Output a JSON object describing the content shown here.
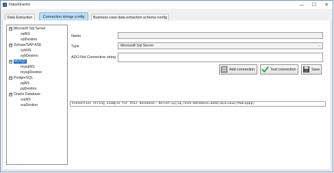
{
  "window": {
    "title": "DataXtractor",
    "minimize_glyph": "—",
    "maximize_glyph": "☐",
    "close_glyph": "✕"
  },
  "tabs": [
    {
      "label": "Data Extraction",
      "active": false
    },
    {
      "label": "Connection strings config",
      "active": true
    },
    {
      "label": "Business case data extraction schema config",
      "active": false
    }
  ],
  "tree": {
    "groups": [
      {
        "label": "Microsoft Sql Server",
        "expander": "⊟",
        "children": [
          "sqlNS",
          "sqlDestino"
        ]
      },
      {
        "label": "Sybase/SAP ASE",
        "expander": "⊟",
        "children": [
          "sybNS",
          "sybDestino"
        ]
      },
      {
        "label": "MySQL",
        "expander": "⊟",
        "selected": true,
        "children": [
          "mysqlNS",
          "mysqlDestino"
        ]
      },
      {
        "label": "PostgreSQL",
        "expander": "⊟",
        "children": [
          "pgNS",
          "pgDestino"
        ]
      },
      {
        "label": "Oracle Database",
        "expander": "⊟",
        "children": [
          "oraNS",
          "oraDestino"
        ]
      }
    ]
  },
  "form": {
    "name_label": "Name",
    "name_value": "",
    "type_label": "Type",
    "type_value": "Microsoft Sql Server",
    "conn_label": "ADO.Net Connection string",
    "conn_value": ""
  },
  "buttons": {
    "add": "Add connection",
    "test": "Test connection",
    "save": "Save"
  },
  "example_text": "Connection string example for this database: Server=ip|ip,nnnn;Database=dddd;Uid=uuuu;Pwd=pppp;",
  "colors": {
    "active_tab": "#b8def7",
    "selection": "#0a64c8",
    "check_green": "#2fa44a"
  }
}
